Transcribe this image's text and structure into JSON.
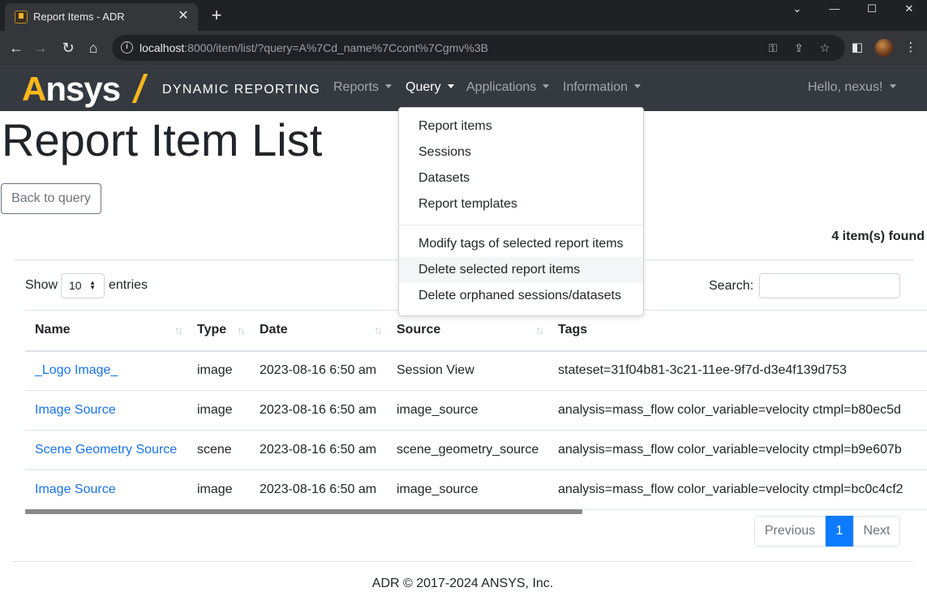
{
  "browser": {
    "tab_title": "Report Items - ADR",
    "tab_close": "✕",
    "new_tab": "+",
    "win_min": "⌄",
    "win_minimize": "—",
    "win_restore": "☐",
    "win_close": "✕",
    "url_host": "localhost",
    "url_rest": ":8000/item/list/?query=A%7Cd_name%7Ccont%7Cgmv%3B",
    "icons": [
      "back-icon",
      "forward-icon",
      "reload-icon",
      "home-icon",
      "info-icon",
      "key-icon",
      "share-icon",
      "star-icon",
      "sidepanel-icon",
      "profile-avatar",
      "menu-icon"
    ]
  },
  "navbar": {
    "brand": "Ansys",
    "product": "DYNAMIC REPORTING",
    "menus": [
      {
        "label": "Reports"
      },
      {
        "label": "Query"
      },
      {
        "label": "Applications"
      },
      {
        "label": "Information"
      }
    ],
    "user": "Hello, nexus!"
  },
  "page": {
    "title": "Report Item List",
    "back_button": "Back to query",
    "found_text": "4 item(s) found"
  },
  "controls": {
    "show_label": "Show",
    "entries_value": "10",
    "entries_label": "entries",
    "search_label": "Search:",
    "search_value": ""
  },
  "table": {
    "columns": [
      "Name",
      "Type",
      "Date",
      "Source",
      "Tags"
    ],
    "rows": [
      {
        "name": "_Logo Image_",
        "type": "image",
        "date": "2023-08-16 6:50 am",
        "source": "Session View",
        "tags": "stateset=31f04b81-3c21-11ee-9f7d-d3e4f139d753"
      },
      {
        "name": "Image Source",
        "type": "image",
        "date": "2023-08-16 6:50 am",
        "source": "image_source",
        "tags": "analysis=mass_flow color_variable=velocity ctmpl=b80ec5d"
      },
      {
        "name": "Scene Geometry Source",
        "type": "scene",
        "date": "2023-08-16 6:50 am",
        "source": "scene_geometry_source",
        "tags": "analysis=mass_flow color_variable=velocity ctmpl=b9e607b"
      },
      {
        "name": "Image Source",
        "type": "image",
        "date": "2023-08-16 6:50 am",
        "source": "image_source",
        "tags": "analysis=mass_flow color_variable=velocity ctmpl=bc0c4cf2"
      }
    ]
  },
  "pagination": {
    "previous": "Previous",
    "current": "1",
    "next": "Next"
  },
  "footer": "ADR © 2017-2024 ANSYS, Inc.",
  "dropdown": {
    "group1": [
      "Report items",
      "Sessions",
      "Datasets",
      "Report templates"
    ],
    "group2": [
      "Modify tags of selected report items",
      "Delete selected report items",
      "Delete orphaned sessions/datasets"
    ]
  },
  "colors": {
    "navbar_bg": "#343a40",
    "brand_accent": "#ffb71b",
    "link": "#1a73e8",
    "page_active": "#0d7bff"
  }
}
